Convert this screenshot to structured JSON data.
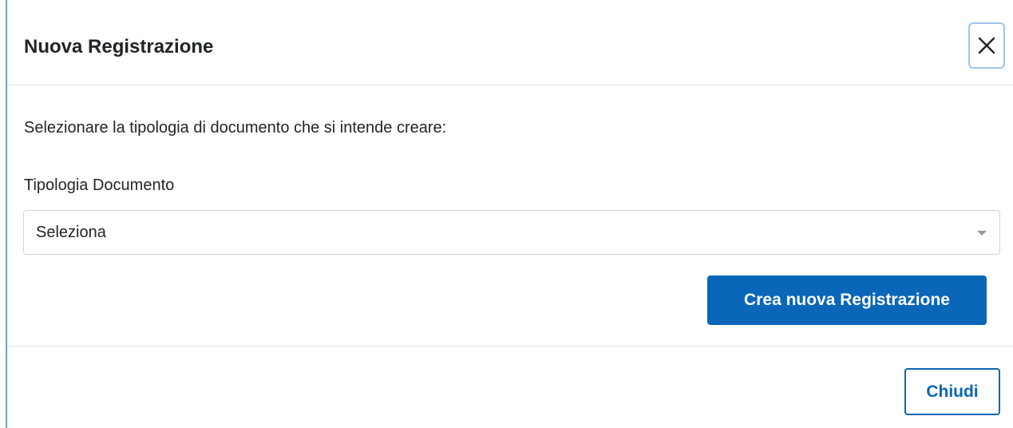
{
  "dialog": {
    "title": "Nuova Registrazione",
    "close_icon": "close-icon",
    "accent_color": "#0a66b8"
  },
  "body": {
    "instruction": "Selezionare la tipologia di documento che si intende creare:",
    "field_label": "Tipologia Documento",
    "select": {
      "selected": "Seleziona",
      "caret_icon": "caret-down-icon"
    },
    "create_button": "Crea nuova Registrazione"
  },
  "footer": {
    "close_button": "Chiudi"
  }
}
